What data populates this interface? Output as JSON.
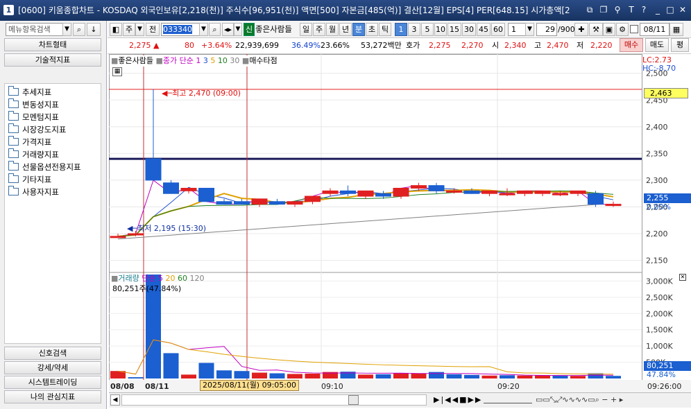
{
  "window": {
    "number": "1",
    "title": "[0600] 키움종합차트 - KOSDAQ 외국인보유[2,218(천)] 주식수[96,951(천)] 액면[500] 자본금[485(억)] 결산[12월] EPS[4] PER[648.15] 시가총액[2"
  },
  "left": {
    "search_placeholder": "메뉴항목검색",
    "chart_type": "차트형태",
    "tech_indicators": "기술적지표",
    "tree": [
      "추세지표",
      "변동성지표",
      "모멘텀지표",
      "시장강도지표",
      "가격지표",
      "거래량지표",
      "선물옵션전용지표",
      "기타지표",
      "사용자지표"
    ],
    "bottom_buttons": [
      "신호검색",
      "강세/약세",
      "시스템트레이딩",
      "나의 관심지표"
    ]
  },
  "toolbar": {
    "chu": "주",
    "jeon": "전",
    "code": "033340",
    "sin": "신",
    "name": "좋은사람들",
    "periods": [
      "일",
      "주",
      "월",
      "년",
      "분",
      "초",
      "틱"
    ],
    "active_period": "분",
    "intervals": [
      "1",
      "3",
      "5",
      "10",
      "15",
      "30",
      "45",
      "60"
    ],
    "active_interval": "1",
    "count_sel": "1",
    "page": "29",
    "page_total": "/900",
    "date": "08/11"
  },
  "price": {
    "current": "2,275",
    "arrow": "▲",
    "change": "80",
    "change_pct": "+3.64%",
    "volume": "22,939,699",
    "vol_ratio": "36.49%",
    "turnover": "23.66%",
    "amount": "53,272백만",
    "hoga_label": "호가",
    "ask": "2,275",
    "bid": "2,270",
    "open_label": "시",
    "open": "2,340",
    "high_label": "고",
    "high": "2,470",
    "low_label": "저",
    "low": "2,220",
    "buy": "매수",
    "sell": "매도",
    "eval": "평"
  },
  "legend_price": {
    "name": "좋은사람들",
    "ma_label": "종가 단순",
    "ma_periods": [
      "1",
      "3",
      "5",
      "10",
      "30"
    ],
    "ma_colors": [
      "#c000c0",
      "#2050d0",
      "#e0a000",
      "#208020",
      "#808080"
    ],
    "signal": "매수타점"
  },
  "annotations": {
    "high": "최고 2,470 (09:00)",
    "low": "최저 2,195 (15:30)",
    "lc": "LC:2.73",
    "hc": "HC:-8.70",
    "current_tag": "2,463",
    "last_price": "2,255",
    "last_pct": "0.00%",
    "crosshair_time": "2025/08/11(월) 09:05:00"
  },
  "legend_volume": {
    "name": "거래량",
    "ma_label": "단순",
    "periods": [
      "5",
      "20",
      "60",
      "120"
    ],
    "colors": [
      "#c000c0",
      "#e0a000",
      "#208020",
      "#808080"
    ],
    "value": "80,251주(47.84%)",
    "last_value": "80,251",
    "last_pct": "47.84%"
  },
  "colors": {
    "up": "#e02020",
    "down": "#1b5fd0",
    "titlebar": "#1e3c72"
  },
  "chart_data": [
    {
      "type": "candlestick",
      "title": "좋은사람들",
      "y_ticks": [
        "2,500",
        "2,450",
        "2,400",
        "2,350",
        "2,300",
        "2,250",
        "2,200",
        "2,150"
      ],
      "ylim": [
        2130,
        2510
      ],
      "x_ticks": [
        "08/08",
        "08/11",
        "09:10",
        "09:20"
      ],
      "x_end_label": "09:26:00",
      "horizontal_line": 2340,
      "candles": [
        {
          "o": 2195,
          "h": 2200,
          "l": 2195,
          "c": 2195
        },
        {
          "o": 2200,
          "h": 2205,
          "l": 2195,
          "c": 2200
        },
        {
          "o": 2340,
          "h": 2470,
          "l": 2300,
          "c": 2300
        },
        {
          "o": 2295,
          "h": 2300,
          "l": 2275,
          "c": 2275
        },
        {
          "o": 2280,
          "h": 2285,
          "l": 2275,
          "c": 2285
        },
        {
          "o": 2285,
          "h": 2285,
          "l": 2260,
          "c": 2260
        },
        {
          "o": 2260,
          "h": 2265,
          "l": 2255,
          "c": 2255
        },
        {
          "o": 2260,
          "h": 2265,
          "l": 2255,
          "c": 2255
        },
        {
          "o": 2255,
          "h": 2265,
          "l": 2250,
          "c": 2265
        },
        {
          "o": 2260,
          "h": 2265,
          "l": 2255,
          "c": 2255
        },
        {
          "o": 2255,
          "h": 2260,
          "l": 2250,
          "c": 2260
        },
        {
          "o": 2260,
          "h": 2270,
          "l": 2255,
          "c": 2270
        },
        {
          "o": 2275,
          "h": 2285,
          "l": 2270,
          "c": 2280
        },
        {
          "o": 2280,
          "h": 2290,
          "l": 2270,
          "c": 2275
        },
        {
          "o": 2270,
          "h": 2280,
          "l": 2265,
          "c": 2280
        },
        {
          "o": 2275,
          "h": 2280,
          "l": 2265,
          "c": 2270
        },
        {
          "o": 2270,
          "h": 2285,
          "l": 2265,
          "c": 2285
        },
        {
          "o": 2285,
          "h": 2295,
          "l": 2280,
          "c": 2290
        },
        {
          "o": 2290,
          "h": 2295,
          "l": 2275,
          "c": 2280
        },
        {
          "o": 2280,
          "h": 2285,
          "l": 2275,
          "c": 2280
        },
        {
          "o": 2280,
          "h": 2285,
          "l": 2275,
          "c": 2275
        },
        {
          "o": 2275,
          "h": 2280,
          "l": 2270,
          "c": 2280
        },
        {
          "o": 2275,
          "h": 2285,
          "l": 2270,
          "c": 2275
        },
        {
          "o": 2275,
          "h": 2280,
          "l": 2270,
          "c": 2280
        },
        {
          "o": 2275,
          "h": 2280,
          "l": 2270,
          "c": 2280
        },
        {
          "o": 2275,
          "h": 2280,
          "l": 2270,
          "c": 2275
        },
        {
          "o": 2275,
          "h": 2280,
          "l": 2270,
          "c": 2280
        },
        {
          "o": 2275,
          "h": 2280,
          "l": 2250,
          "c": 2255
        },
        {
          "o": 2255,
          "h": 2260,
          "l": 2250,
          "c": 2255
        }
      ]
    },
    {
      "type": "bar",
      "title": "거래량",
      "y_ticks": [
        "3,000K",
        "2,500K",
        "2,000K",
        "1,500K",
        "1,000K",
        "500K"
      ],
      "ylim": [
        0,
        3200000
      ],
      "values": [
        230000,
        40000,
        3300000,
        780000,
        120000,
        480000,
        250000,
        230000,
        180000,
        160000,
        140000,
        150000,
        200000,
        210000,
        120000,
        130000,
        170000,
        150000,
        200000,
        130000,
        110000,
        90000,
        100000,
        90000,
        95000,
        90000,
        80000,
        160000,
        80251
      ],
      "up": [
        true,
        false,
        false,
        false,
        true,
        false,
        false,
        false,
        true,
        false,
        true,
        true,
        true,
        false,
        true,
        false,
        true,
        true,
        false,
        false,
        false,
        true,
        false,
        true,
        true,
        false,
        true,
        false,
        false
      ]
    }
  ]
}
